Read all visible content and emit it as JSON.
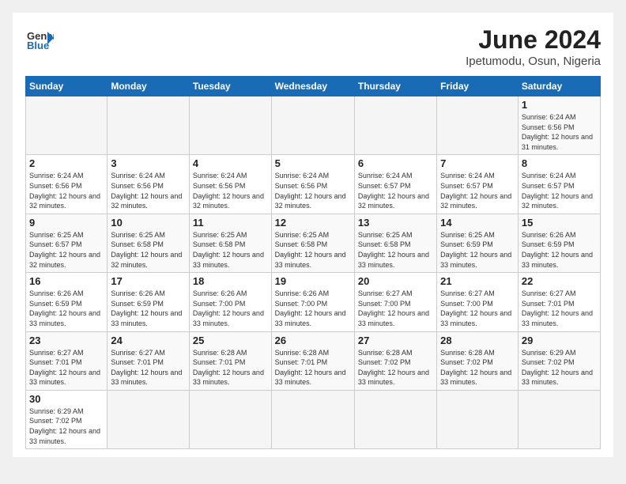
{
  "logo": {
    "line1": "General",
    "line2": "Blue"
  },
  "title": {
    "month": "June 2024",
    "location": "Ipetumodu, Osun, Nigeria"
  },
  "weekdays": [
    "Sunday",
    "Monday",
    "Tuesday",
    "Wednesday",
    "Thursday",
    "Friday",
    "Saturday"
  ],
  "weeks": [
    [
      {
        "day": "",
        "info": ""
      },
      {
        "day": "",
        "info": ""
      },
      {
        "day": "",
        "info": ""
      },
      {
        "day": "",
        "info": ""
      },
      {
        "day": "",
        "info": ""
      },
      {
        "day": "",
        "info": ""
      },
      {
        "day": "1",
        "info": "Sunrise: 6:24 AM\nSunset: 6:56 PM\nDaylight: 12 hours and 31 minutes."
      }
    ],
    [
      {
        "day": "2",
        "info": "Sunrise: 6:24 AM\nSunset: 6:56 PM\nDaylight: 12 hours and 32 minutes."
      },
      {
        "day": "3",
        "info": "Sunrise: 6:24 AM\nSunset: 6:56 PM\nDaylight: 12 hours and 32 minutes."
      },
      {
        "day": "4",
        "info": "Sunrise: 6:24 AM\nSunset: 6:56 PM\nDaylight: 12 hours and 32 minutes."
      },
      {
        "day": "5",
        "info": "Sunrise: 6:24 AM\nSunset: 6:56 PM\nDaylight: 12 hours and 32 minutes."
      },
      {
        "day": "6",
        "info": "Sunrise: 6:24 AM\nSunset: 6:57 PM\nDaylight: 12 hours and 32 minutes."
      },
      {
        "day": "7",
        "info": "Sunrise: 6:24 AM\nSunset: 6:57 PM\nDaylight: 12 hours and 32 minutes."
      },
      {
        "day": "8",
        "info": "Sunrise: 6:24 AM\nSunset: 6:57 PM\nDaylight: 12 hours and 32 minutes."
      }
    ],
    [
      {
        "day": "9",
        "info": "Sunrise: 6:25 AM\nSunset: 6:57 PM\nDaylight: 12 hours and 32 minutes."
      },
      {
        "day": "10",
        "info": "Sunrise: 6:25 AM\nSunset: 6:58 PM\nDaylight: 12 hours and 32 minutes."
      },
      {
        "day": "11",
        "info": "Sunrise: 6:25 AM\nSunset: 6:58 PM\nDaylight: 12 hours and 33 minutes."
      },
      {
        "day": "12",
        "info": "Sunrise: 6:25 AM\nSunset: 6:58 PM\nDaylight: 12 hours and 33 minutes."
      },
      {
        "day": "13",
        "info": "Sunrise: 6:25 AM\nSunset: 6:58 PM\nDaylight: 12 hours and 33 minutes."
      },
      {
        "day": "14",
        "info": "Sunrise: 6:25 AM\nSunset: 6:59 PM\nDaylight: 12 hours and 33 minutes."
      },
      {
        "day": "15",
        "info": "Sunrise: 6:26 AM\nSunset: 6:59 PM\nDaylight: 12 hours and 33 minutes."
      }
    ],
    [
      {
        "day": "16",
        "info": "Sunrise: 6:26 AM\nSunset: 6:59 PM\nDaylight: 12 hours and 33 minutes."
      },
      {
        "day": "17",
        "info": "Sunrise: 6:26 AM\nSunset: 6:59 PM\nDaylight: 12 hours and 33 minutes."
      },
      {
        "day": "18",
        "info": "Sunrise: 6:26 AM\nSunset: 7:00 PM\nDaylight: 12 hours and 33 minutes."
      },
      {
        "day": "19",
        "info": "Sunrise: 6:26 AM\nSunset: 7:00 PM\nDaylight: 12 hours and 33 minutes."
      },
      {
        "day": "20",
        "info": "Sunrise: 6:27 AM\nSunset: 7:00 PM\nDaylight: 12 hours and 33 minutes."
      },
      {
        "day": "21",
        "info": "Sunrise: 6:27 AM\nSunset: 7:00 PM\nDaylight: 12 hours and 33 minutes."
      },
      {
        "day": "22",
        "info": "Sunrise: 6:27 AM\nSunset: 7:01 PM\nDaylight: 12 hours and 33 minutes."
      }
    ],
    [
      {
        "day": "23",
        "info": "Sunrise: 6:27 AM\nSunset: 7:01 PM\nDaylight: 12 hours and 33 minutes."
      },
      {
        "day": "24",
        "info": "Sunrise: 6:27 AM\nSunset: 7:01 PM\nDaylight: 12 hours and 33 minutes."
      },
      {
        "day": "25",
        "info": "Sunrise: 6:28 AM\nSunset: 7:01 PM\nDaylight: 12 hours and 33 minutes."
      },
      {
        "day": "26",
        "info": "Sunrise: 6:28 AM\nSunset: 7:01 PM\nDaylight: 12 hours and 33 minutes."
      },
      {
        "day": "27",
        "info": "Sunrise: 6:28 AM\nSunset: 7:02 PM\nDaylight: 12 hours and 33 minutes."
      },
      {
        "day": "28",
        "info": "Sunrise: 6:28 AM\nSunset: 7:02 PM\nDaylight: 12 hours and 33 minutes."
      },
      {
        "day": "29",
        "info": "Sunrise: 6:29 AM\nSunset: 7:02 PM\nDaylight: 12 hours and 33 minutes."
      }
    ],
    [
      {
        "day": "30",
        "info": "Sunrise: 6:29 AM\nSunset: 7:02 PM\nDaylight: 12 hours and 33 minutes."
      },
      {
        "day": "",
        "info": ""
      },
      {
        "day": "",
        "info": ""
      },
      {
        "day": "",
        "info": ""
      },
      {
        "day": "",
        "info": ""
      },
      {
        "day": "",
        "info": ""
      },
      {
        "day": "",
        "info": ""
      }
    ]
  ]
}
